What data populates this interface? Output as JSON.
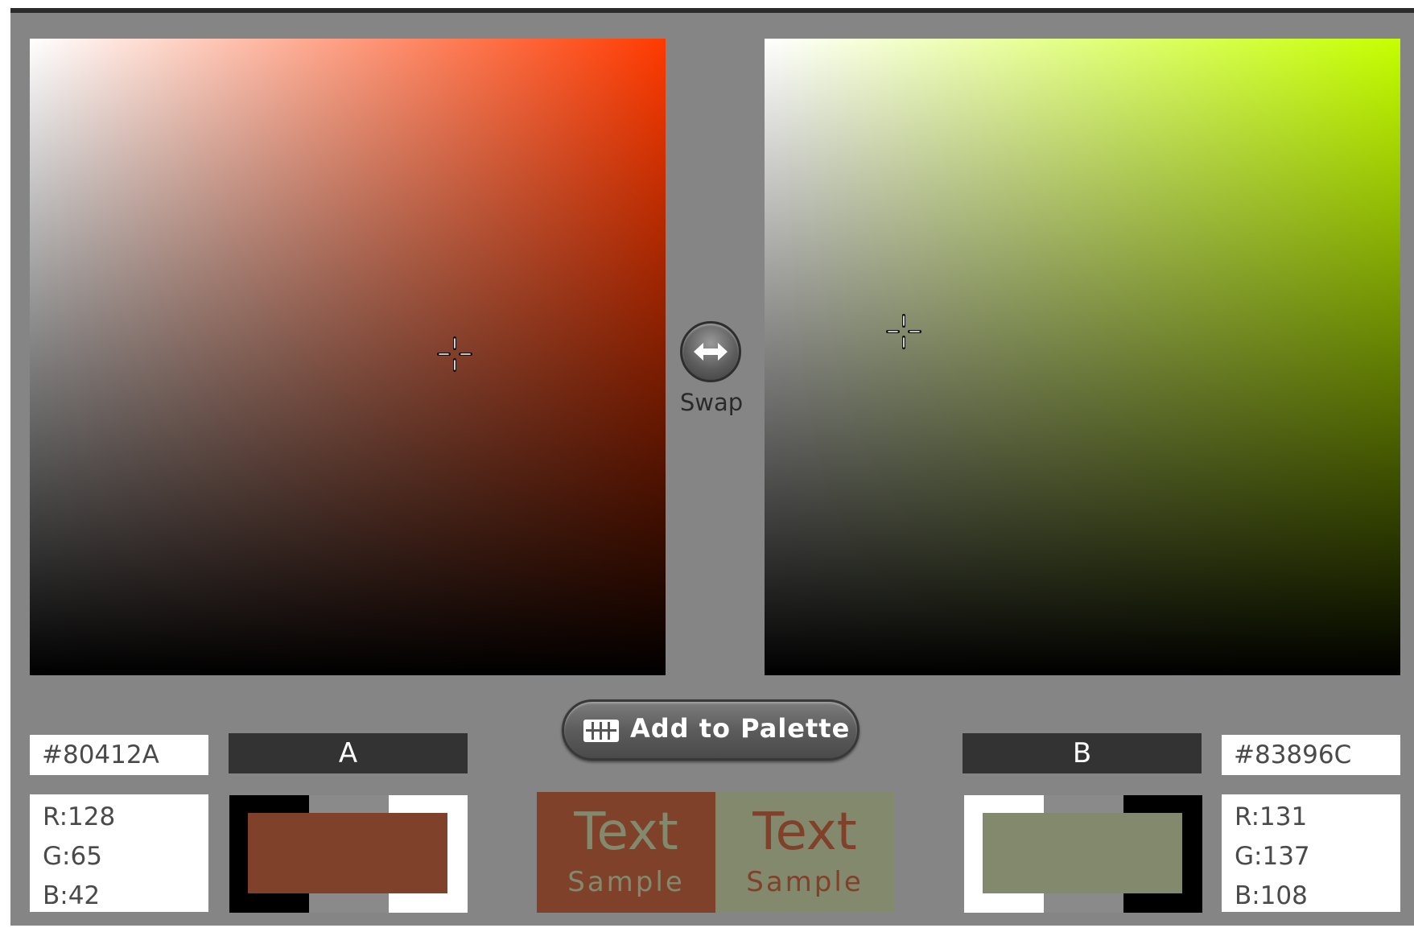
{
  "colors": {
    "a": {
      "label": "A",
      "hex": "#80412A",
      "rgb": {
        "r": "R:128",
        "g": "G:65",
        "b": "B:42"
      },
      "picker_hue": "#ff3a00",
      "swatch_frame": [
        "#000000",
        "#8a8a8a",
        "#ffffff"
      ]
    },
    "b": {
      "label": "B",
      "hex": "#83896C",
      "rgb": {
        "r": "R:131",
        "g": "G:137",
        "b": "B:108"
      },
      "picker_hue": "#c6ff00",
      "swatch_frame": [
        "#ffffff",
        "#8a8a8a",
        "#000000"
      ]
    }
  },
  "swap": {
    "label": "Swap"
  },
  "add_to_palette": {
    "label": "Add to Palette"
  },
  "text_sample": {
    "big": "Text",
    "small": "Sample"
  },
  "icons": {
    "crosshair": "crosshair-icon",
    "swap": "swap-arrows-icon",
    "palette": "palette-grid-icon"
  }
}
